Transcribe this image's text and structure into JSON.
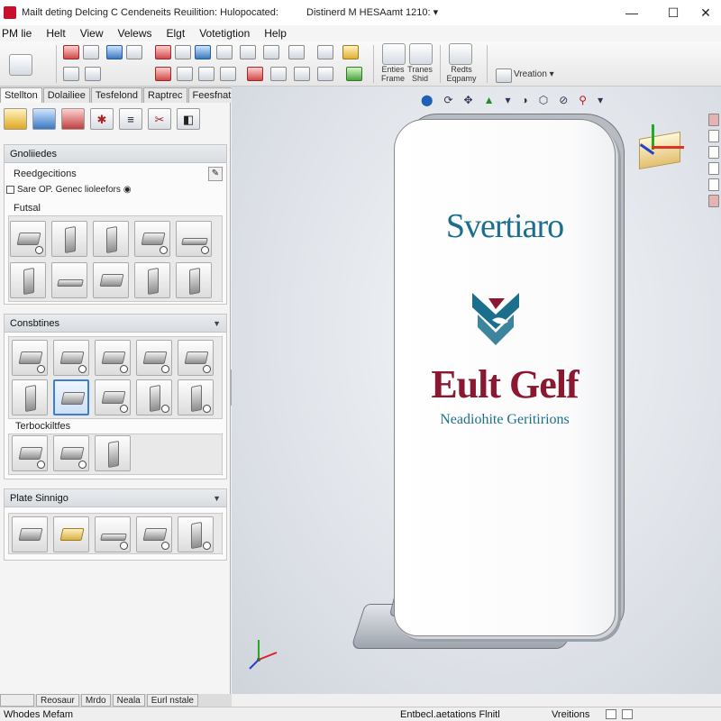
{
  "window": {
    "title": "Mailt deting Delcing C Cendeneits Reuilition: Hulopocated:",
    "document_title": "Distinerd M HESAamt 1210: ▾",
    "minimize_label": "—",
    "maximize_label": "☐",
    "close_label": "✕"
  },
  "menu": {
    "items": [
      "PM lie",
      "Helt",
      "View",
      "Velews",
      "Elgt",
      "Votetigtion",
      "Help"
    ]
  },
  "toolbar": {
    "group_labels": [
      {
        "line1": "Enties",
        "line2": "Frame"
      },
      {
        "line1": "Tranes",
        "line2": "Shid"
      },
      {
        "line1": "Redts",
        "line2": "Eqpamy"
      }
    ],
    "dropdown_label": "Vreation ▾"
  },
  "tabs": [
    "Stellton",
    "Dolailiee",
    "Tesfelond",
    "Raptrec",
    "Feesfnatioins"
  ],
  "sections": {
    "generation": {
      "header": "Gnoliiedes",
      "subheader": "Reedgecitions",
      "option": "Sare OP. Genec lioleefors",
      "fused_label": "Futsal"
    },
    "constraints": {
      "header": "Consbtines",
      "subheader": "Terbockiltfes"
    },
    "plate": {
      "header": "Plate Sinnigo"
    }
  },
  "viewport": {
    "sign_top": "Svertiaro",
    "sign_main": "Eult Gelf",
    "sign_sub": "Neadiohite Geritirions",
    "accent_blue": "#1b6f8c",
    "accent_red": "#8a1830"
  },
  "bottom_tabs": [
    "",
    "Reosaur",
    "Mrdo",
    "Neala",
    "Eurl nstale"
  ],
  "status": {
    "left": "Whodes Mefam",
    "middle": "Entbecl.aetations Flnitl",
    "right": "Vreitions"
  }
}
